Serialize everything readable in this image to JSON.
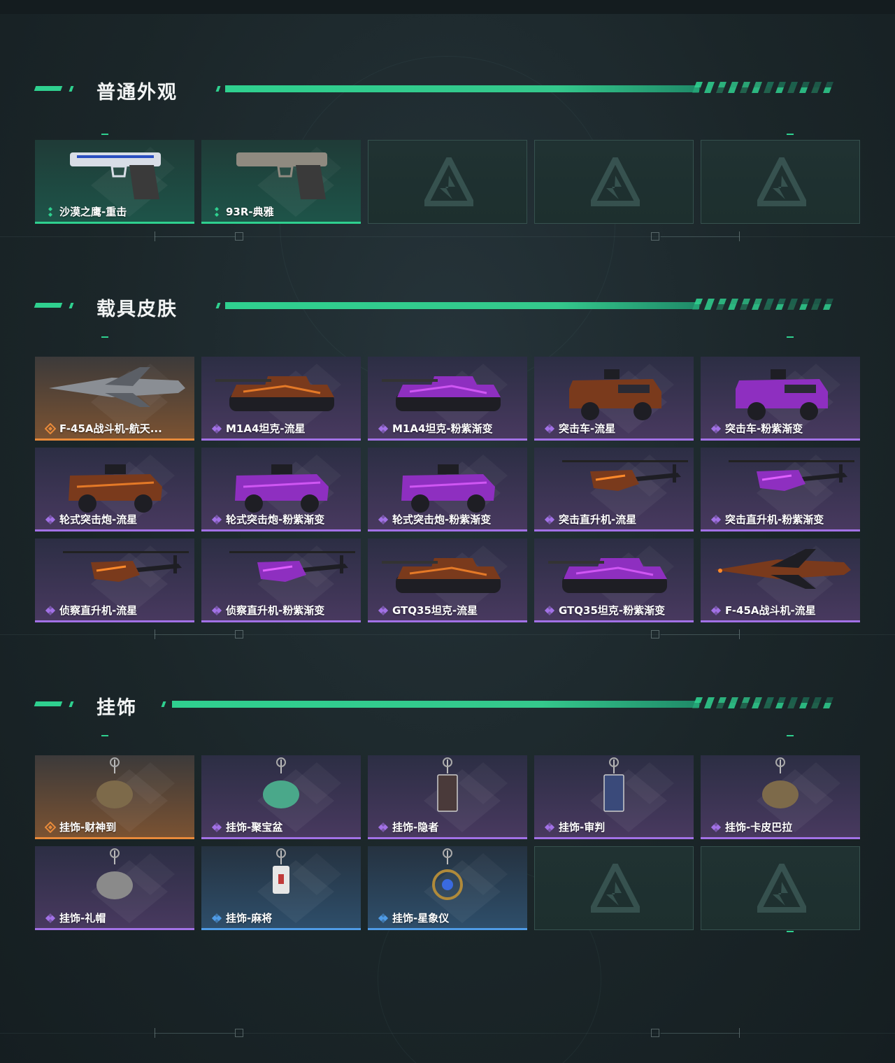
{
  "sections": [
    {
      "title": "普通外观",
      "items": [
        {
          "name": "沙漠之鹰-重击",
          "rarity": "green"
        },
        {
          "name": "93R-典雅",
          "rarity": "green"
        },
        {
          "name": "",
          "rarity": "empty"
        },
        {
          "name": "",
          "rarity": "empty"
        },
        {
          "name": "",
          "rarity": "empty"
        }
      ]
    },
    {
      "title": "载具皮肤",
      "items": [
        {
          "name": "F-45A战斗机-航天...",
          "rarity": "orange"
        },
        {
          "name": "M1A4坦克-流星",
          "rarity": "purple"
        },
        {
          "name": "M1A4坦克-粉紫渐变",
          "rarity": "purple"
        },
        {
          "name": "突击车-流星",
          "rarity": "purple"
        },
        {
          "name": "突击车-粉紫渐变",
          "rarity": "purple"
        },
        {
          "name": "轮式突击炮-流星",
          "rarity": "purple"
        },
        {
          "name": "轮式突击炮-粉紫渐变",
          "rarity": "purple"
        },
        {
          "name": "轮式突击炮-粉紫渐变",
          "rarity": "purple"
        },
        {
          "name": "突击直升机-流星",
          "rarity": "purple"
        },
        {
          "name": "突击直升机-粉紫渐变",
          "rarity": "purple"
        },
        {
          "name": "侦察直升机-流星",
          "rarity": "purple"
        },
        {
          "name": "侦察直升机-粉紫渐变",
          "rarity": "purple"
        },
        {
          "name": "GTQ35坦克-流星",
          "rarity": "purple"
        },
        {
          "name": "GTQ35坦克-粉紫渐变",
          "rarity": "purple"
        },
        {
          "name": "F-45A战斗机-流星",
          "rarity": "purple"
        }
      ]
    },
    {
      "title": "挂饰",
      "items": [
        {
          "name": "挂饰-财神到",
          "rarity": "orange"
        },
        {
          "name": "挂饰-聚宝盆",
          "rarity": "purple"
        },
        {
          "name": "挂饰-隐者",
          "rarity": "purple"
        },
        {
          "name": "挂饰-审判",
          "rarity": "purple"
        },
        {
          "name": "挂饰-卡皮巴拉",
          "rarity": "purple"
        },
        {
          "name": "挂饰-礼帽",
          "rarity": "purple"
        },
        {
          "name": "挂饰-麻将",
          "rarity": "blue"
        },
        {
          "name": "挂饰-星象仪",
          "rarity": "blue"
        },
        {
          "name": "",
          "rarity": "empty"
        },
        {
          "name": "",
          "rarity": "empty"
        }
      ]
    }
  ],
  "colors": {
    "accent": "#2fd08f",
    "orange": "#e88a3a",
    "purple": "#a271e6",
    "blue": "#4f9be6"
  }
}
